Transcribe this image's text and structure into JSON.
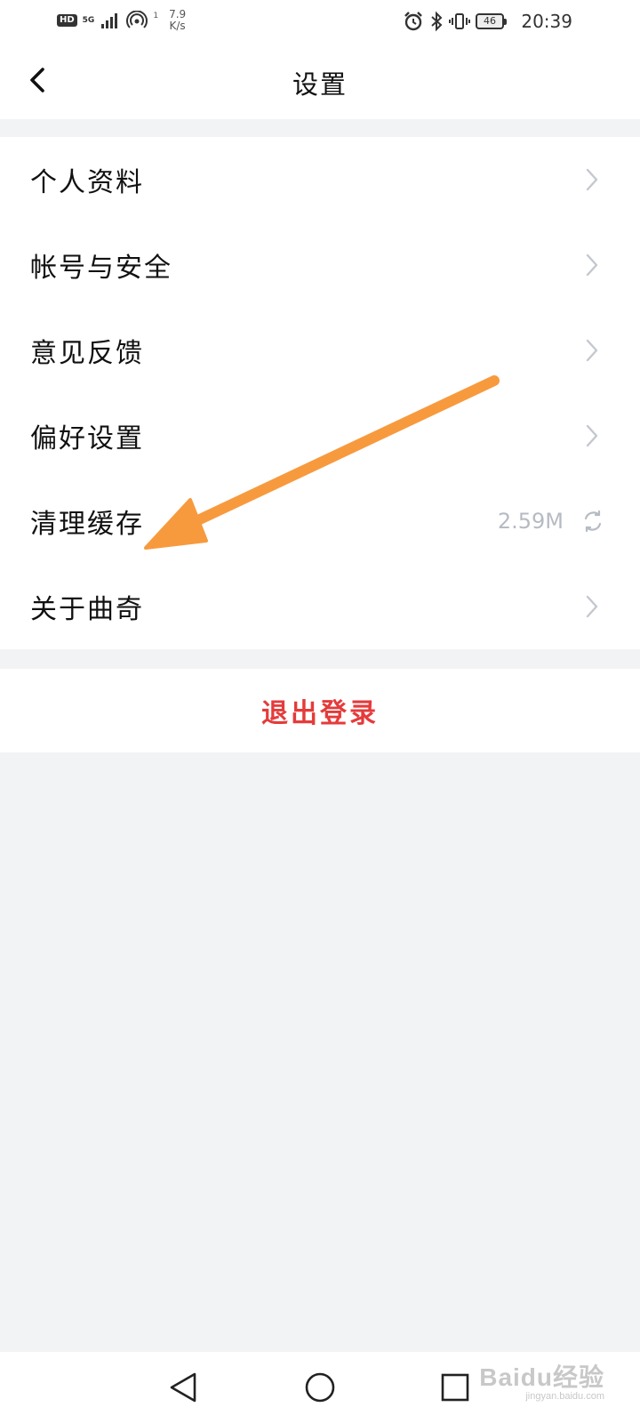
{
  "status_bar": {
    "hd_badge": "HD",
    "network": "5G",
    "speed_value": "7.9",
    "speed_unit": "K/s",
    "hotspot_count": "1",
    "battery_level": "46",
    "time": "20:39"
  },
  "header": {
    "title": "设置"
  },
  "menu": {
    "items": [
      {
        "label": "个人资料"
      },
      {
        "label": "帐号与安全"
      },
      {
        "label": "意见反馈"
      },
      {
        "label": "偏好设置"
      },
      {
        "label": "清理缓存",
        "value": "2.59M"
      },
      {
        "label": "关于曲奇"
      }
    ]
  },
  "logout_label": "退出登录",
  "annotation": {
    "arrow_color": "#f79a3e"
  },
  "watermark": {
    "main": "Baidu经验",
    "sub": "jingyan.baidu.com"
  },
  "colors": {
    "page_bg": "#f2f3f5",
    "logout_text": "#e53b3b",
    "muted_text": "#b6bbc3"
  }
}
